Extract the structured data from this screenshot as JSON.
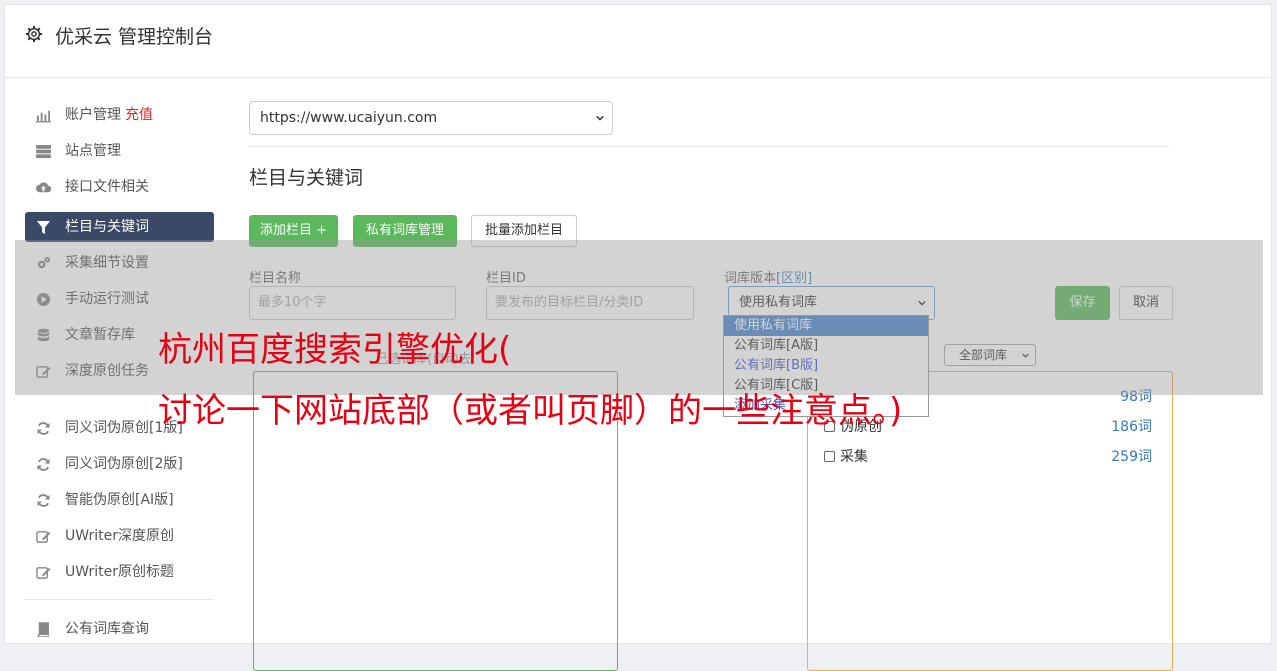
{
  "header": {
    "title": "优采云 管理控制台"
  },
  "sidebar": {
    "items": [
      {
        "label": "账户管理",
        "badge": "充值",
        "icon": "bar-chart-icon"
      },
      {
        "label": "站点管理",
        "icon": "server-icon"
      },
      {
        "label": "接口文件相关",
        "icon": "cloud-upload-icon"
      },
      {
        "label": "栏目与关键词",
        "icon": "filter-icon",
        "active": true
      },
      {
        "label": "采集细节设置",
        "icon": "gears-icon"
      },
      {
        "label": "手动运行测试",
        "icon": "play-circle-icon"
      },
      {
        "label": "文章暂存库",
        "icon": "database-icon"
      },
      {
        "label": "深度原创任务",
        "icon": "edit-icon"
      },
      {
        "label": "同义词伪原创[1版]",
        "icon": "refresh-icon"
      },
      {
        "label": "同义词伪原创[2版]",
        "icon": "refresh-icon"
      },
      {
        "label": "智能伪原创[AI版]",
        "icon": "refresh-icon"
      },
      {
        "label": "UWriter深度原创",
        "icon": "edit-icon"
      },
      {
        "label": "UWriter原创标题",
        "icon": "edit-icon"
      },
      {
        "label": "公有词库查询",
        "icon": "book-icon"
      }
    ]
  },
  "main": {
    "site_select": {
      "value": "https://www.ucaiyun.com"
    },
    "section_title": "栏目与关键词",
    "buttons": {
      "add_column": "添加栏目 +",
      "private_lib": "私有词库管理",
      "batch_add": "批量添加栏目"
    },
    "form": {
      "name_label": "栏目名称",
      "name_placeholder": "最多10个字",
      "id_label": "栏目ID",
      "id_placeholder": "要发布的目标栏目/分类ID",
      "version_label": "词库版本",
      "version_link": "[区别]",
      "version_value": "使用私有词库",
      "save": "保存",
      "cancel": "取消"
    },
    "dropdown_options": [
      "使用私有词库",
      "公有词库[A版]",
      "公有词库[B版]",
      "公有词库[C版]",
      "添加采集"
    ],
    "library_filter": "全部词库",
    "left_box_label": "已选词库(自动去",
    "libraries": [
      {
        "name": "",
        "count": "98词"
      },
      {
        "name": "伪原创",
        "count": "186词"
      },
      {
        "name": "采集",
        "count": "259词"
      }
    ]
  },
  "overlay_text": {
    "line1": "杭州百度搜索引擎优化(",
    "line2": "讨论一下网站底部（或者叫页脚）的一些注意点。)"
  }
}
